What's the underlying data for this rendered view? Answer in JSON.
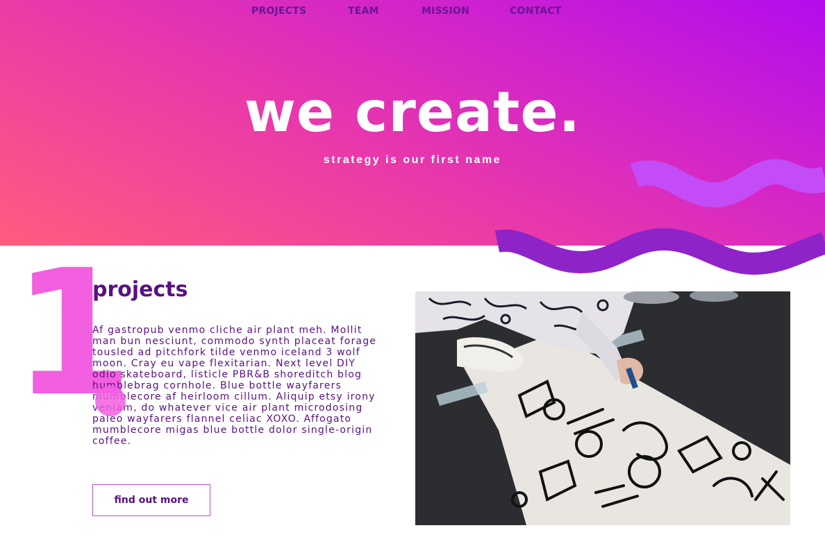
{
  "nav": {
    "links": [
      "PROJECTS",
      "TEAM",
      "MISSION",
      "CONTACT"
    ]
  },
  "hero": {
    "title": "we create.",
    "subtitle": "strategy is our first name"
  },
  "section": {
    "number": "1",
    "title": "projects",
    "body": "Af gastropub venmo cliche air plant meh. Mollit man bun nesciunt, commodo synth placeat forage tousled ad pitchfork tilde venmo iceland 3 wolf moon. Cray eu vape flexitarian. Next level DIY odio skateboard, listicle PBR&B shoreditch blog humblebrag cornhole. Blue bottle wayfarers mumblecore af heirloom cillum. Aliquip etsy irony veniam, do whatever vice air plant microdosing paleo wayfarers flannel celiac XOXO. Affogato mumblecore migas blue bottle dolor single-origin coffee.",
    "button_label": "find out more"
  },
  "colors": {
    "accent_purple": "#5a0f84",
    "accent_pink": "#f25fe0",
    "wave_light": "#c34cf7",
    "wave_dark": "#8e24c8"
  }
}
